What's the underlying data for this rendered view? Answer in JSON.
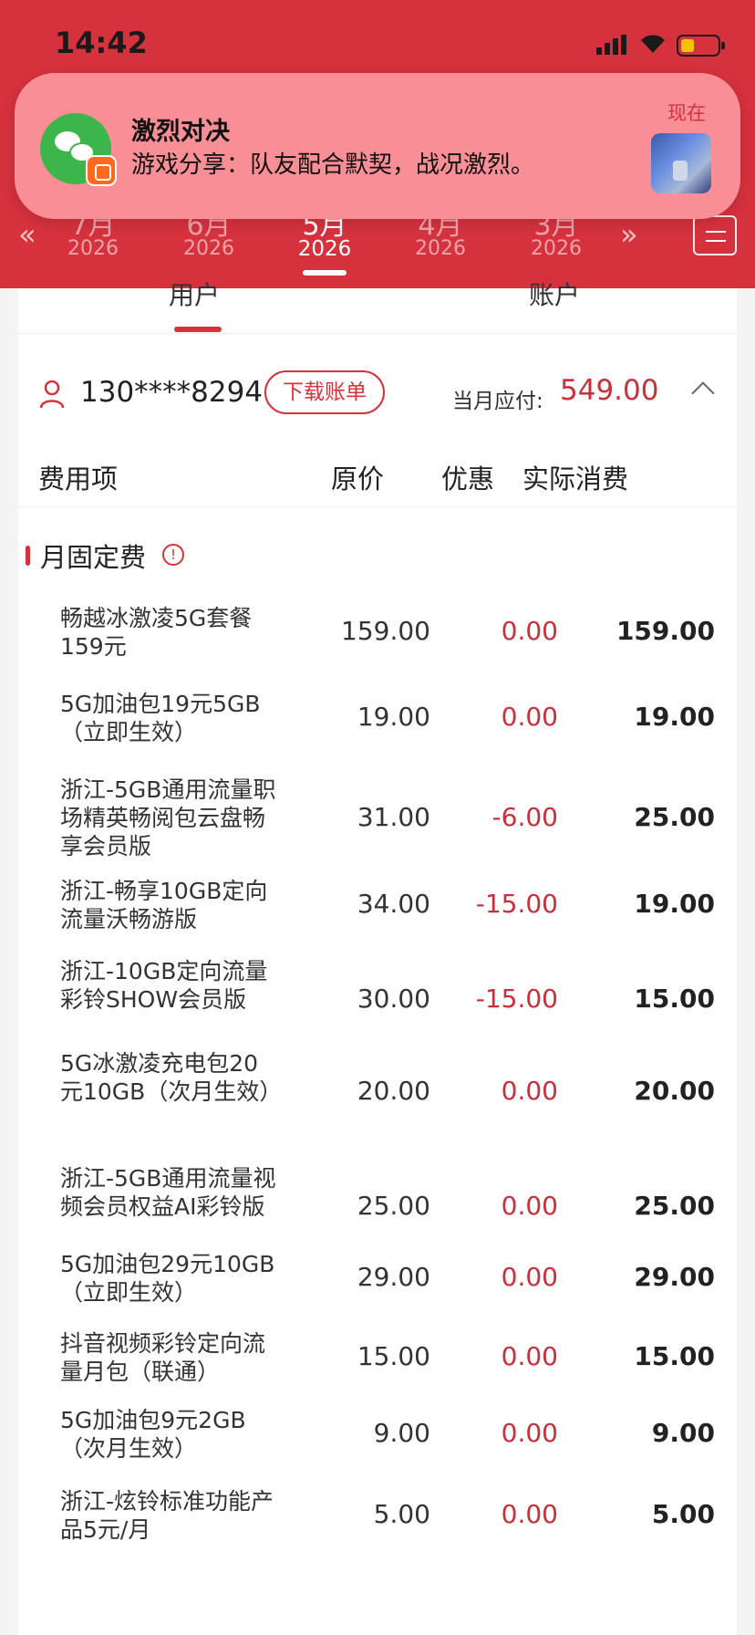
{
  "status_bar": {
    "time": "14:42"
  },
  "month_selector": {
    "prev_arrow": "«",
    "next_arrow": "»",
    "months": [
      {
        "month": "7月",
        "year": "2026",
        "selected": false
      },
      {
        "month": "6月",
        "year": "2026",
        "selected": false
      },
      {
        "month": "5月",
        "year": "2026",
        "selected": true
      },
      {
        "month": "4月",
        "year": "2026",
        "selected": false
      },
      {
        "month": "3月",
        "year": "2026",
        "selected": false
      }
    ]
  },
  "notification": {
    "app_icon": "wechat-icon",
    "badge_icon": "kuaishou-icon",
    "title": "激烈对决",
    "body": "游戏分享：队友配合默契，战况激烈。",
    "time": "现在"
  },
  "tabs": [
    {
      "label": "用户",
      "active": true
    },
    {
      "label": "账户",
      "active": false
    }
  ],
  "account": {
    "phone": "130****8294",
    "download_label": "下载账单",
    "due_label": "当月应付:",
    "due_amount": "549.00"
  },
  "table": {
    "headers": {
      "item": "费用项",
      "original": "原价",
      "discount": "优惠",
      "actual": "实际消费"
    },
    "section_title": "月固定费",
    "rows": [
      {
        "name": "畅越冰激凌5G套餐159元",
        "original": "159.00",
        "discount": "0.00",
        "actual": "159.00"
      },
      {
        "name": "5G加油包19元5GB（立即生效）",
        "original": "19.00",
        "discount": "0.00",
        "actual": "19.00"
      },
      {
        "name": "浙江-5GB通用流量职场精英畅阅包云盘畅享会员版",
        "original": "31.00",
        "discount": "-6.00",
        "actual": "25.00"
      },
      {
        "name": "浙江-畅享10GB定向流量沃畅游版",
        "original": "34.00",
        "discount": "-15.00",
        "actual": "19.00"
      },
      {
        "name": "浙江-10GB定向流量彩铃SHOW会员版",
        "original": "30.00",
        "discount": "-15.00",
        "actual": "15.00"
      },
      {
        "name": "5G冰激凌充电包20元10GB（次月生效）",
        "original": "20.00",
        "discount": "0.00",
        "actual": "20.00"
      },
      {
        "name": "浙江-5GB通用流量视频会员权益AI彩铃版",
        "original": "25.00",
        "discount": "0.00",
        "actual": "25.00"
      },
      {
        "name": "5G加油包29元10GB（立即生效）",
        "original": "29.00",
        "discount": "0.00",
        "actual": "29.00"
      },
      {
        "name": "抖音视频彩铃定向流量月包（联通）",
        "original": "15.00",
        "discount": "0.00",
        "actual": "15.00"
      },
      {
        "name": "5G加油包9元2GB（次月生效）",
        "original": "9.00",
        "discount": "0.00",
        "actual": "9.00"
      },
      {
        "name": "浙江-炫铃标准功能产品5元/月",
        "original": "5.00",
        "discount": "0.00",
        "actual": "5.00"
      }
    ]
  },
  "colors": {
    "brand_red": "#d6323e",
    "notification_bg": "#f88e96",
    "discount_red": "#c8303c"
  }
}
